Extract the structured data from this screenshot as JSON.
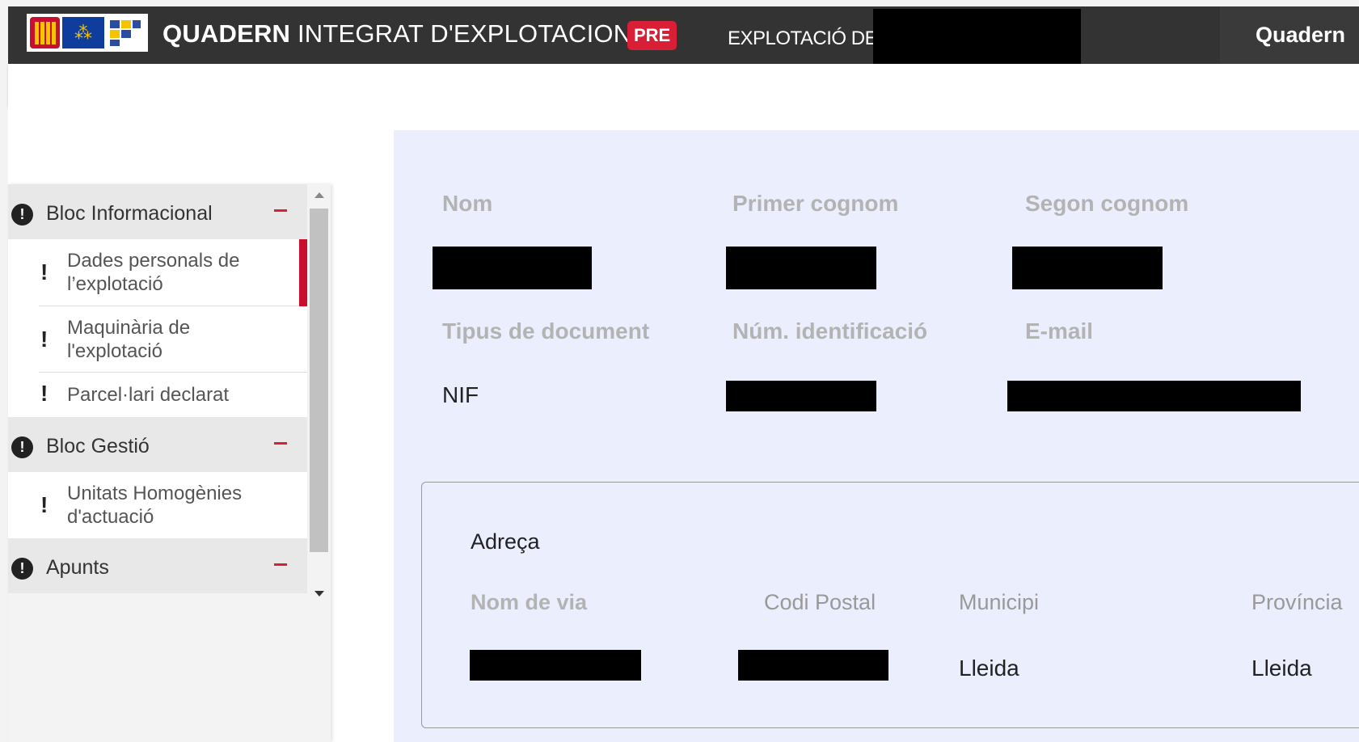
{
  "header": {
    "title_bold": "QUADERN",
    "title_rest": " INTEGRAT D'EXPLOTACIONS",
    "env_badge": "PRE",
    "explotacio_label": "EXPLOTACIÓ DE:",
    "right_label": "Quadern"
  },
  "sidebar": {
    "groups": [
      {
        "label": "Bloc Informacional",
        "icon": "exclamation-circle-icon",
        "toggle": "collapse"
      },
      {
        "label": "Bloc Gestió",
        "icon": "exclamation-circle-icon",
        "toggle": "collapse"
      },
      {
        "label": "Apunts",
        "icon": "exclamation-circle-icon",
        "toggle": "collapse"
      }
    ],
    "items": [
      {
        "line1": "Dades personals de",
        "line2": "l’explotació",
        "active": true
      },
      {
        "line1": "Maquinària de",
        "line2": "l'explotació",
        "active": false
      },
      {
        "line1": "Parcel·lari declarat",
        "line2": "",
        "active": false
      },
      {
        "line1": "Unitats Homogènies",
        "line2": "d'actuació",
        "active": false
      }
    ]
  },
  "form": {
    "labels": {
      "nom": "Nom",
      "primer_cognom": "Primer cognom",
      "segon_cognom": "Segon cognom",
      "tipus_document": "Tipus de document",
      "num_identificacio": "Núm. identificació",
      "email": "E-mail"
    },
    "values": {
      "tipus_document": "NIF"
    }
  },
  "address": {
    "title": "Adreça",
    "labels": {
      "nom_via": "Nom de via",
      "codi_postal": "Codi Postal",
      "municipi": "Municipi",
      "provincia": "Província"
    },
    "values": {
      "municipi": "Lleida",
      "provincia": "Lleida"
    }
  },
  "colors": {
    "header_bg": "#333333",
    "accent_red": "#d81f35",
    "panel_bg": "#ebeffd"
  }
}
